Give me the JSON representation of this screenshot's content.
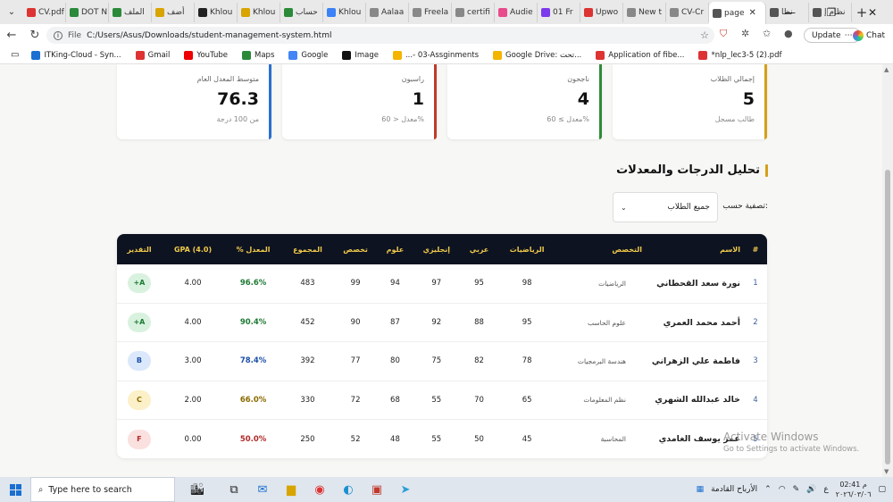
{
  "browser": {
    "tabs": [
      {
        "label": "CV.pdf",
        "color": "#d33"
      },
      {
        "label": "DOT N",
        "color": "#2a8a3a"
      },
      {
        "label": "الملف",
        "color": "#2a8a3a"
      },
      {
        "label": "أضف",
        "color": "#d8a400"
      },
      {
        "label": "Khlou",
        "color": "#222"
      },
      {
        "label": "Khlou",
        "color": "#d8a400"
      },
      {
        "label": "حساب",
        "color": "#2a8a3a"
      },
      {
        "label": "Khlou",
        "color": "#3b82f6"
      },
      {
        "label": "Aalaa",
        "color": "#888"
      },
      {
        "label": "Freela",
        "color": "#888"
      },
      {
        "label": "certifi",
        "color": "#888"
      },
      {
        "label": "Audie",
        "color": "#e84c8a"
      },
      {
        "label": "01 Fr",
        "color": "#7c3aed"
      },
      {
        "label": "Upwo",
        "color": "#d33"
      },
      {
        "label": "New t",
        "color": "#888"
      },
      {
        "label": "CV-Cr",
        "color": "#888"
      },
      {
        "label": "page",
        "color": "#555"
      },
      {
        "label": "نظا",
        "color": "#555"
      },
      {
        "label": "نظام إ",
        "color": "#555"
      }
    ],
    "url_scheme": "File",
    "url": "C:/Users/Asus/Downloads/student-management-system.html",
    "update_label": "Update",
    "chat_label": "Chat",
    "bookmarks": [
      {
        "label": "ITKing-Cloud - Syn...",
        "color": "#1a6fd1"
      },
      {
        "label": "Gmail",
        "color": "#d33"
      },
      {
        "label": "YouTube",
        "color": "#e00"
      },
      {
        "label": "Maps",
        "color": "#2a8a3a"
      },
      {
        "label": "Google",
        "color": "#4285f4"
      },
      {
        "label": "Image",
        "color": "#111"
      },
      {
        "label": "...- 03-Assginments",
        "color": "#f4b400"
      },
      {
        "label": "Google Drive: تحت...",
        "color": "#f4b400"
      },
      {
        "label": "Application of fibe...",
        "color": "#d33"
      },
      {
        "label": "*nlp_lec3-5 (2).pdf",
        "color": "#d33"
      }
    ]
  },
  "stats": [
    {
      "label": "إجمالي الطلاب",
      "value": "5",
      "sub": "طالب مسجل",
      "color": "#d4a017"
    },
    {
      "label": "ناجحون",
      "value": "4",
      "sub": "معدل ≥ 60%",
      "color": "#2e8b3a"
    },
    {
      "label": "راسبون",
      "value": "1",
      "sub": "معدل < 60%",
      "color": "#c0392b"
    },
    {
      "label": "متوسط المعدل العام",
      "value": "76.3",
      "sub": "من 100 درجة",
      "color": "#2a6fd1"
    }
  ],
  "section_title": "تحليل الدرجات والمعدلات",
  "filter": {
    "label": "تصفية حسب:",
    "selected": "جميع الطلاب"
  },
  "table": {
    "headers": [
      "#",
      "الاسم",
      "التخصص",
      "الرياضيات",
      "عربي",
      "إنجليزي",
      "علوم",
      "تخصص",
      "المجموع",
      "المعدل %",
      "GPA (4.0)",
      "التقدير"
    ],
    "rows": [
      {
        "idx": "1",
        "name": "نورة سعد القحطاني",
        "spec": "الرياضيات",
        "math": "98",
        "arabic": "95",
        "english": "97",
        "science": "94",
        "major": "99",
        "total": "483",
        "pct": "96.6%",
        "gpa": "4.00",
        "grade": "A+",
        "grade_bg": "#d9f2df",
        "grade_fg": "#1e7a34",
        "pct_color": "#1e7a34"
      },
      {
        "idx": "2",
        "name": "أحمد محمد العمري",
        "spec": "علوم الحاسب",
        "math": "95",
        "arabic": "88",
        "english": "92",
        "science": "87",
        "major": "90",
        "total": "452",
        "pct": "90.4%",
        "gpa": "4.00",
        "grade": "A+",
        "grade_bg": "#d9f2df",
        "grade_fg": "#1e7a34",
        "pct_color": "#1e7a34"
      },
      {
        "idx": "3",
        "name": "فاطمة علي الزهراني",
        "spec": "هندسة البرمجيات",
        "math": "78",
        "arabic": "82",
        "english": "75",
        "science": "80",
        "major": "77",
        "total": "392",
        "pct": "78.4%",
        "gpa": "3.00",
        "grade": "B",
        "grade_bg": "#dbe8fb",
        "grade_fg": "#1d4fa8",
        "pct_color": "#1d4fa8"
      },
      {
        "idx": "4",
        "name": "خالد عبدالله الشهري",
        "spec": "نظم المعلومات",
        "math": "65",
        "arabic": "70",
        "english": "55",
        "science": "68",
        "major": "72",
        "total": "330",
        "pct": "66.0%",
        "gpa": "2.00",
        "grade": "C",
        "grade_bg": "#fbf0c8",
        "grade_fg": "#8a6a00",
        "pct_color": "#8a6a00"
      },
      {
        "idx": "5",
        "name": "عمر يوسف الغامدي",
        "spec": "المحاسبة",
        "math": "45",
        "arabic": "50",
        "english": "55",
        "science": "48",
        "major": "52",
        "total": "250",
        "pct": "50.0%",
        "gpa": "0.00",
        "grade": "F",
        "grade_bg": "#fbe0e0",
        "grade_fg": "#b02a2a",
        "pct_color": "#b02a2a"
      }
    ]
  },
  "watermark": {
    "title": "Activate Windows",
    "sub": "Go to Settings to activate Windows."
  },
  "taskbar": {
    "search_placeholder": "Type here to search",
    "tray_label": "الأرباح القادمة",
    "lang": "ع",
    "time": "02:41 م",
    "date": "٢٠٢٦/٠٣/٠٦"
  }
}
